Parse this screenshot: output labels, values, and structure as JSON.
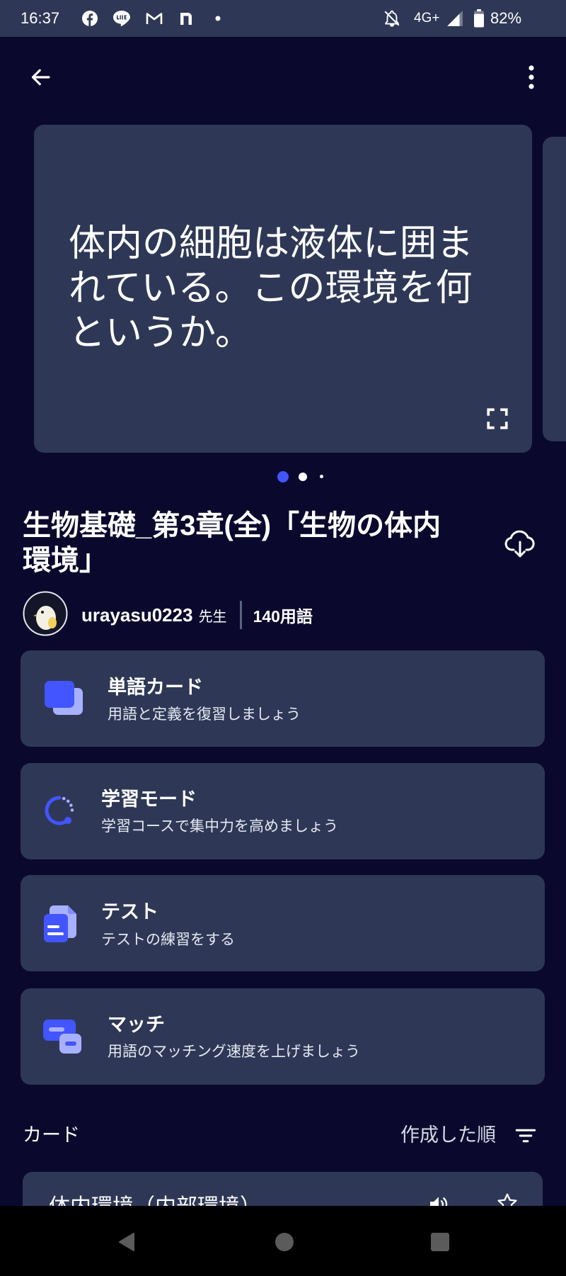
{
  "status_bar": {
    "time": "16:37",
    "network": "4G+",
    "battery": "82%",
    "left_icons": [
      "facebook-icon",
      "line-icon",
      "gmail-icon",
      "n-app-icon",
      "notification-dot-icon"
    ],
    "right_icons": [
      "mute-icon",
      "signal-icon",
      "battery-icon"
    ]
  },
  "top_bar": {
    "back_icon": "arrow-left-icon",
    "menu_icon": "more-vert-icon"
  },
  "preview": {
    "term": "体内の細胞は液体に囲まれている。この環境を何というか。",
    "expand_icon": "fullscreen-icon",
    "pages": 3,
    "active_index": 0
  },
  "set": {
    "title": "生物基礎_第3章(全)「生物の体内環境」",
    "download_icon": "cloud-download-icon"
  },
  "author": {
    "username": "urayasu0223",
    "role": "先生",
    "term_count": "140用語"
  },
  "study_modes": [
    {
      "title": "単語カード",
      "subtitle": "用語と定義を復習しましょう",
      "icon": "flashcards-icon"
    },
    {
      "title": "学習モード",
      "subtitle": "学習コースで集中力を高めましょう",
      "icon": "learn-icon"
    },
    {
      "title": "テスト",
      "subtitle": "テストの練習をする",
      "icon": "test-icon"
    },
    {
      "title": "マッチ",
      "subtitle": "用語のマッチング速度を上げましょう",
      "icon": "match-icon"
    }
  ],
  "cards_section": {
    "heading": "カード",
    "sort_label": "作成した順",
    "sort_icon": "filter-icon"
  },
  "first_card": {
    "term": "体内環境（内部環境）",
    "audio_icon": "speaker-icon",
    "star_icon": "star-icon"
  },
  "nav_bar": {
    "icons": [
      "nav-back-icon",
      "nav-home-icon",
      "nav-recents-icon"
    ]
  },
  "colors": {
    "background": "#0a092d",
    "surface": "#2e3856",
    "accent": "#4255ff",
    "accent_light": "#a8b1ff",
    "text": "#ffffff"
  }
}
